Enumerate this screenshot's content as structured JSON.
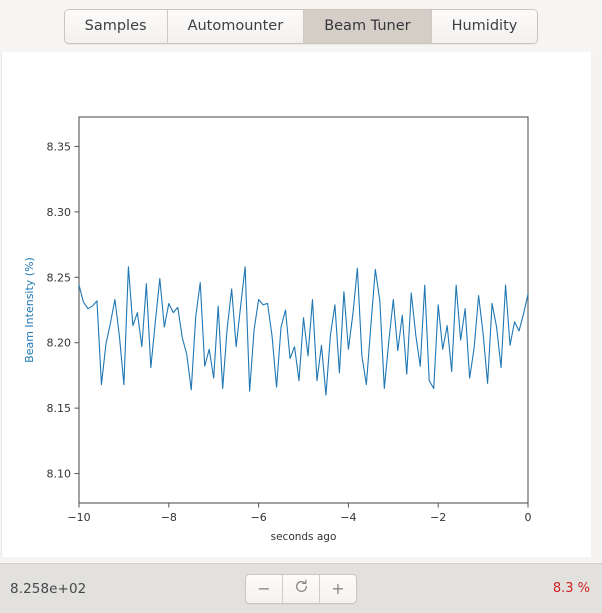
{
  "tabs": [
    {
      "label": "Samples",
      "active": false
    },
    {
      "label": "Automounter",
      "active": false
    },
    {
      "label": "Beam Tuner",
      "active": true
    },
    {
      "label": "Humidity",
      "active": false
    }
  ],
  "statusbar": {
    "value_label": "8.258e+02",
    "percent_label": "8.3 %",
    "minus_label": "−",
    "refresh_label": "refresh-icon",
    "plus_label": "+",
    "percent_color": "#d02020"
  },
  "chart_data": {
    "type": "line",
    "title": "",
    "xlabel": "seconds ago",
    "ylabel": "Beam Intensity (%)",
    "ylabel_color": "#1f77b4",
    "line_color": "#1f77b4",
    "grid": false,
    "legend": "none",
    "xlim": [
      -10,
      0
    ],
    "ylim": [
      8.0775,
      8.3725
    ],
    "xticks": [
      -10,
      -8,
      -6,
      -4,
      -2,
      0
    ],
    "xticklabels": [
      "−10",
      "−8",
      "−6",
      "−4",
      "−2",
      "0"
    ],
    "yticks": [
      8.1,
      8.15,
      8.2,
      8.25,
      8.3,
      8.35
    ],
    "yticklabels": [
      "8.10",
      "8.15",
      "8.20",
      "8.25",
      "8.30",
      "8.35"
    ],
    "series": [
      {
        "name": "Beam Intensity",
        "x": [
          -10.0,
          -9.9,
          -9.8,
          -9.7,
          -9.6,
          -9.5,
          -9.4,
          -9.3,
          -9.2,
          -9.1,
          -9.0,
          -8.9,
          -8.8,
          -8.7,
          -8.6,
          -8.5,
          -8.4,
          -8.3,
          -8.2,
          -8.1,
          -8.0,
          -7.9,
          -7.8,
          -7.7,
          -7.6,
          -7.5,
          -7.4,
          -7.3,
          -7.2,
          -7.1,
          -7.0,
          -6.9,
          -6.8,
          -6.7,
          -6.6,
          -6.5,
          -6.4,
          -6.3,
          -6.2,
          -6.1,
          -6.0,
          -5.9,
          -5.8,
          -5.7,
          -5.6,
          -5.5,
          -5.4,
          -5.3,
          -5.2,
          -5.1,
          -5.0,
          -4.9,
          -4.8,
          -4.7,
          -4.6,
          -4.5,
          -4.4,
          -4.3,
          -4.2,
          -4.1,
          -4.0,
          -3.9,
          -3.8,
          -3.7,
          -3.6,
          -3.5,
          -3.4,
          -3.3,
          -3.2,
          -3.1,
          -3.0,
          -2.9,
          -2.8,
          -2.7,
          -2.6,
          -2.5,
          -2.4,
          -2.3,
          -2.2,
          -2.1,
          -2.0,
          -1.9,
          -1.8,
          -1.7,
          -1.6,
          -1.5,
          -1.4,
          -1.3,
          -1.2,
          -1.1,
          -1.0,
          -0.9,
          -0.8,
          -0.7,
          -0.6,
          -0.5,
          -0.4,
          -0.3,
          -0.2,
          -0.1,
          0.0
        ],
        "values": [
          8.244,
          8.231,
          8.226,
          8.228,
          8.232,
          8.168,
          8.199,
          8.215,
          8.233,
          8.205,
          8.168,
          8.258,
          8.213,
          8.223,
          8.197,
          8.245,
          8.181,
          8.216,
          8.249,
          8.212,
          8.23,
          8.223,
          8.227,
          8.204,
          8.191,
          8.164,
          8.22,
          8.246,
          8.182,
          8.195,
          8.173,
          8.228,
          8.165,
          8.211,
          8.241,
          8.197,
          8.228,
          8.258,
          8.163,
          8.21,
          8.233,
          8.229,
          8.23,
          8.205,
          8.166,
          8.212,
          8.225,
          8.188,
          8.197,
          8.171,
          8.219,
          8.19,
          8.233,
          8.171,
          8.198,
          8.16,
          8.206,
          8.229,
          8.177,
          8.239,
          8.195,
          8.222,
          8.257,
          8.19,
          8.168,
          8.213,
          8.256,
          8.232,
          8.165,
          8.201,
          8.233,
          8.194,
          8.221,
          8.176,
          8.238,
          8.206,
          8.182,
          8.244,
          8.171,
          8.165,
          8.229,
          8.195,
          8.213,
          8.178,
          8.244,
          8.202,
          8.226,
          8.173,
          8.196,
          8.236,
          8.207,
          8.169,
          8.23,
          8.212,
          8.181,
          8.244,
          8.198,
          8.216,
          8.209,
          8.222,
          8.237
        ]
      }
    ]
  }
}
